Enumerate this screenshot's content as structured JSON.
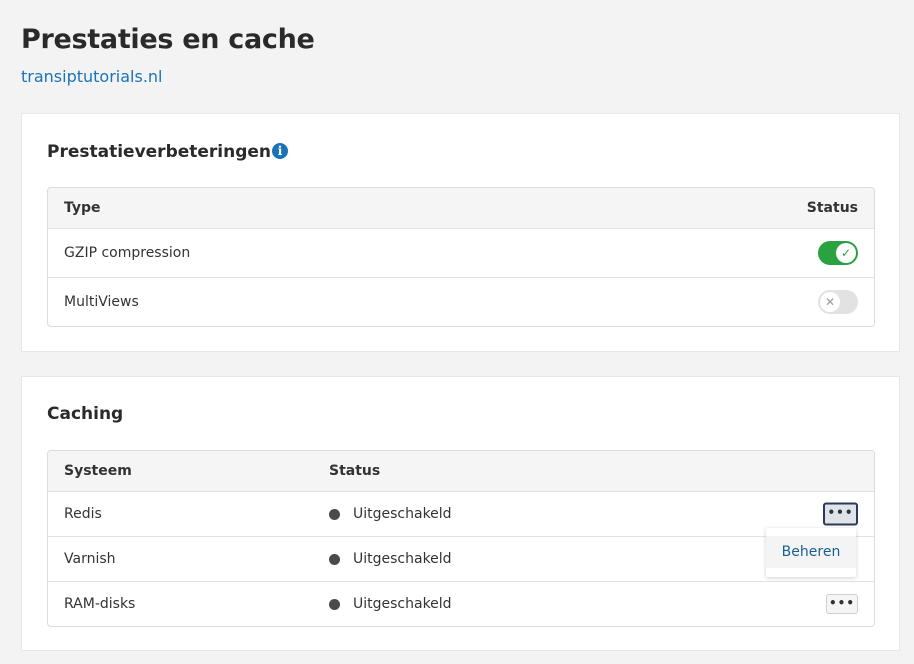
{
  "page": {
    "title": "Prestaties en cache",
    "domain": "transiptutorials.nl"
  },
  "performance": {
    "title": "Prestatieverbeteringen",
    "info_icon": "info-icon",
    "columns": {
      "type": "Type",
      "status": "Status"
    },
    "rows": [
      {
        "name": "GZIP compression",
        "enabled": true
      },
      {
        "name": "MultiViews",
        "enabled": false
      }
    ],
    "toggle_on_color": "#2aa23f"
  },
  "caching": {
    "title": "Caching",
    "columns": {
      "system": "Systeem",
      "status": "Status"
    },
    "rows": [
      {
        "name": "Redis",
        "status": "Uitgeschakeld"
      },
      {
        "name": "Varnish",
        "status": "Uitgeschakeld"
      },
      {
        "name": "RAM-disks",
        "status": "Uitgeschakeld"
      }
    ],
    "menu_label": "•••",
    "dropdown": {
      "item": "Beheren"
    }
  },
  "colors": {
    "link": "#1a73b5",
    "status_dot": "#4a4a4a"
  }
}
